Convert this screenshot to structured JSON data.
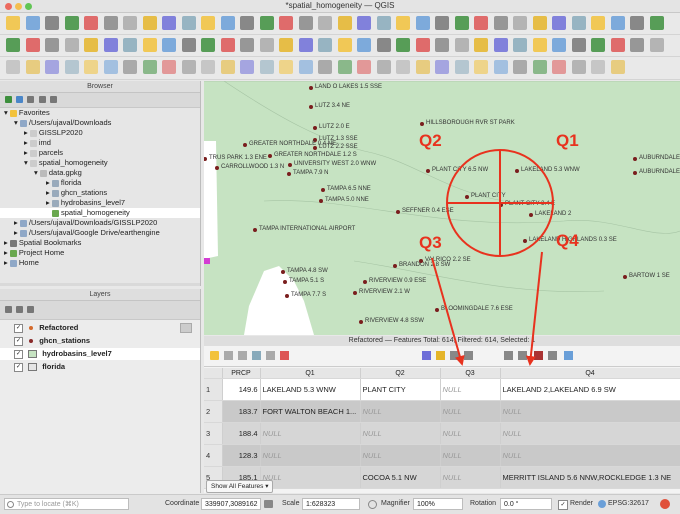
{
  "window": {
    "title": "*spatial_homogeneity — QGIS"
  },
  "browser": {
    "title": "Browser",
    "items": [
      {
        "label": "Favorites"
      },
      {
        "label": "/Users/ujaval/Downloads"
      },
      {
        "label": "GISSLP2020"
      },
      {
        "label": "imd"
      },
      {
        "label": "parcels"
      },
      {
        "label": "spatial_homogeneity"
      },
      {
        "label": "data.gpkg"
      },
      {
        "label": "florida"
      },
      {
        "label": "ghcn_stations"
      },
      {
        "label": "hydrobasins_level7"
      },
      {
        "label": "spatial_homogeneity"
      },
      {
        "label": "/Users/ujaval/Downloads/GISSLP2020"
      },
      {
        "label": "/Users/ujaval/Google Drive/earthengine"
      },
      {
        "label": "Spatial Bookmarks"
      },
      {
        "label": "Project Home"
      },
      {
        "label": "Home"
      }
    ]
  },
  "layers": {
    "title": "Layers",
    "items": [
      {
        "label": "Refactored",
        "color": "#d46a2c"
      },
      {
        "label": "ghcn_stations",
        "color": "#8a2a2a"
      },
      {
        "label": "hydrobasins_level7",
        "color": "#c6e3c2"
      },
      {
        "label": "florida",
        "color": "#e5e5e5"
      }
    ]
  },
  "map": {
    "labels": [
      "LAND O LAKES 1.5 SSE",
      "LUTZ 3.4 NE",
      "HILLSBOROUGH RVR ST PARK",
      "LUTZ 2.0 E",
      "LUTZ 1.3 SSE",
      "LUTZ 2.2 SSE",
      "GREATER NORTHDALE 0.4 NE",
      "GREATER NORTHDALE 1.2 S",
      "UNIVERSITY WEST 2.0 WNW",
      "TRUS PARK 1.3 ENE",
      "CARROLLWOOD 1.3 N",
      "TAMPA 7.9 N",
      "PLANT CITY 6.5 NW",
      "LAKELAND 5.3 WNW",
      "AUBURNDALE 1.4 NNE",
      "AUBURNDALE 1.3 SSE",
      "TAMPA 6.5 NNE",
      "TAMPA 5.0 NNE",
      "PLANT CITY",
      "PLANT CITY 3.4 E",
      "LAKELAND 2",
      "SEFFNER 0.4 ESE",
      "TAMPA INTERNATIONAL AIRPORT",
      "LAKELAND HIGHLANDS 0.3 SE",
      "BRANDON 2.8 SW",
      "VALRICO 2.2 SE",
      "TAMPA 4.8 SW",
      "TAMPA 5.1 S",
      "RIVERVIEW 0.9 ESE",
      "TAMPA 7.7 S",
      "RIVERVIEW 2.1 W",
      "BARTOW 1 SE",
      "BLOOMINGDALE 7.6 ESE",
      "RIVERVIEW 4.8 SSW"
    ],
    "quadrants": [
      "Q1",
      "Q2",
      "Q3",
      "Q4"
    ],
    "annotation_color": "#e8321e"
  },
  "attribute_table": {
    "title": "Refactored — Features Total: 614, Filtered: 614, Selected: 1",
    "columns": [
      "PRCP",
      "Q1",
      "Q2",
      "Q3",
      "Q4"
    ],
    "rows": [
      {
        "num": "1",
        "prcp": "149.6",
        "q1": "LAKELAND 5.3 WNW",
        "q2": "PLANT CITY",
        "q3": "NULL",
        "q4": "LAKELAND 2,LAKELAND 6.9 SW"
      },
      {
        "num": "2",
        "prcp": "183.7",
        "q1": "FORT WALTON BEACH 1...",
        "q2": "NULL",
        "q3": "NULL",
        "q4": "NULL"
      },
      {
        "num": "3",
        "prcp": "188.4",
        "q1": "NULL",
        "q2": "NULL",
        "q3": "NULL",
        "q4": "NULL"
      },
      {
        "num": "4",
        "prcp": "128.3",
        "q1": "NULL",
        "q2": "NULL",
        "q3": "NULL",
        "q4": "NULL"
      },
      {
        "num": "5",
        "prcp": "185.1",
        "q1": "NULL",
        "q2": "COCOA 5.1 NW",
        "q3": "NULL",
        "q4": "MERRITT ISLAND 5.6 NNW,ROCKLEDGE 1.3 NE"
      }
    ],
    "show_all_label": "Show All Features"
  },
  "status": {
    "locate_placeholder": "Type to locate (⌘K)",
    "coordinate_label": "Coordinate",
    "coordinate_value": "339907,3089162",
    "scale_label": "Scale",
    "scale_value": "1:628323",
    "magnifier_label": "Magnifier",
    "magnifier_value": "100%",
    "rotation_label": "Rotation",
    "rotation_value": "0.0 °",
    "render_label": "Render",
    "crs": "EPSG:32617"
  }
}
